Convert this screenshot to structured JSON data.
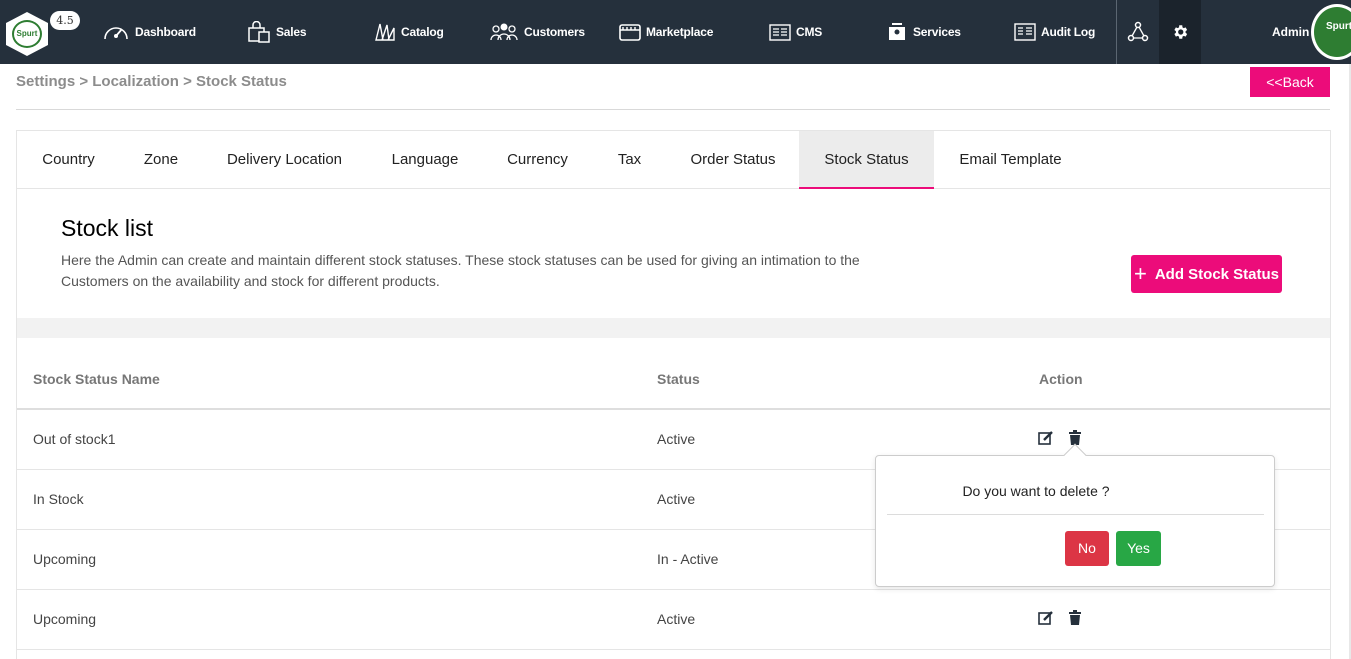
{
  "app": {
    "version": "4.5",
    "logo_text": "Spurt",
    "admin_label": "Admin"
  },
  "nav": [
    {
      "label": "Dashboard",
      "icon": "speedometer-icon"
    },
    {
      "label": "Sales",
      "icon": "shopping-bag-icon"
    },
    {
      "label": "Catalog",
      "icon": "catalog-icon"
    },
    {
      "label": "Customers",
      "icon": "users-icon"
    },
    {
      "label": "Marketplace",
      "icon": "store-icon"
    },
    {
      "label": "CMS",
      "icon": "cms-icon"
    },
    {
      "label": "Services",
      "icon": "services-icon"
    },
    {
      "label": "Audit Log",
      "icon": "audit-log-icon"
    }
  ],
  "breadcrumb": "Settings > Localization > Stock Status",
  "back_label": "<<Back",
  "tabs": [
    {
      "label": "Country"
    },
    {
      "label": "Zone"
    },
    {
      "label": "Delivery Location"
    },
    {
      "label": "Language"
    },
    {
      "label": "Currency"
    },
    {
      "label": "Tax"
    },
    {
      "label": "Order Status"
    },
    {
      "label": "Stock Status",
      "active": true
    },
    {
      "label": "Email Template"
    }
  ],
  "page": {
    "title": "Stock list",
    "description": "Here the Admin can create and maintain different stock statuses. These stock statuses can be used for giving an intimation to the Customers on the availability and stock for different products.",
    "add_button": "Add Stock Status"
  },
  "table": {
    "headers": {
      "name": "Stock Status Name",
      "status": "Status",
      "action": "Action"
    },
    "rows": [
      {
        "name": "Out of stock1",
        "status": "Active"
      },
      {
        "name": "In Stock",
        "status": "Active"
      },
      {
        "name": "Upcoming",
        "status": "In - Active"
      },
      {
        "name": "Upcoming",
        "status": "Active"
      }
    ]
  },
  "popover": {
    "question": "Do you want to delete ?",
    "no": "No",
    "yes": "Yes"
  },
  "colors": {
    "nav_bg": "#25303c",
    "accent": "#ec0c7a",
    "danger": "#dc3545",
    "success": "#28a745"
  }
}
